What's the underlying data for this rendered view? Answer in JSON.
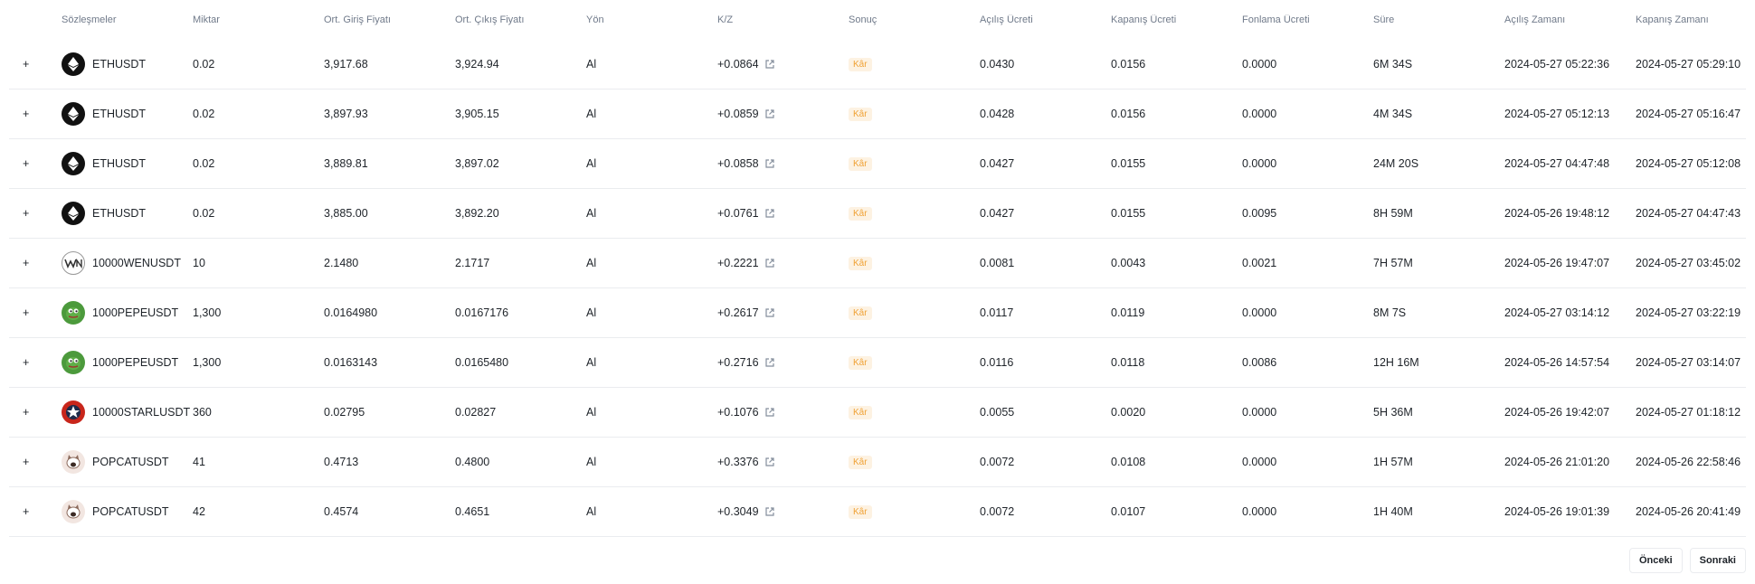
{
  "table": {
    "headers": [
      "Sözleşmeler",
      "Miktar",
      "Ort. Giriş Fiyatı",
      "Ort. Çıkış Fiyatı",
      "Yön",
      "K/Z",
      "Sonuç",
      "Açılış Ücreti",
      "Kapanış Ücreti",
      "Fonlama Ücreti",
      "Süre",
      "Açılış Zamanı",
      "Kapanış Zamanı"
    ],
    "rows": [
      {
        "contract": "ETHUSDT",
        "icon": "eth-icon",
        "qty": "0.02",
        "entry": "3,917.68",
        "exit": "3,924.94",
        "side": "Al",
        "pnl": "+0.0864",
        "result": "Kâr",
        "open_fee": "0.0430",
        "close_fee": "0.0156",
        "funding_fee": "0.0000",
        "duration": "6M 34S",
        "open_time": "2024-05-27 05:22:36",
        "close_time": "2024-05-27 05:29:10"
      },
      {
        "contract": "ETHUSDT",
        "icon": "eth-icon",
        "qty": "0.02",
        "entry": "3,897.93",
        "exit": "3,905.15",
        "side": "Al",
        "pnl": "+0.0859",
        "result": "Kâr",
        "open_fee": "0.0428",
        "close_fee": "0.0156",
        "funding_fee": "0.0000",
        "duration": "4M 34S",
        "open_time": "2024-05-27 05:12:13",
        "close_time": "2024-05-27 05:16:47"
      },
      {
        "contract": "ETHUSDT",
        "icon": "eth-icon",
        "qty": "0.02",
        "entry": "3,889.81",
        "exit": "3,897.02",
        "side": "Al",
        "pnl": "+0.0858",
        "result": "Kâr",
        "open_fee": "0.0427",
        "close_fee": "0.0155",
        "funding_fee": "0.0000",
        "duration": "24M 20S",
        "open_time": "2024-05-27 04:47:48",
        "close_time": "2024-05-27 05:12:08"
      },
      {
        "contract": "ETHUSDT",
        "icon": "eth-icon",
        "qty": "0.02",
        "entry": "3,885.00",
        "exit": "3,892.20",
        "side": "Al",
        "pnl": "+0.0761",
        "result": "Kâr",
        "open_fee": "0.0427",
        "close_fee": "0.0155",
        "funding_fee": "0.0095",
        "duration": "8H 59M",
        "open_time": "2024-05-26 19:48:12",
        "close_time": "2024-05-27 04:47:43"
      },
      {
        "contract": "10000WENUSDT",
        "icon": "wen-icon",
        "qty": "10",
        "entry": "2.1480",
        "exit": "2.1717",
        "side": "Al",
        "pnl": "+0.2221",
        "result": "Kâr",
        "open_fee": "0.0081",
        "close_fee": "0.0043",
        "funding_fee": "0.0021",
        "duration": "7H 57M",
        "open_time": "2024-05-26 19:47:07",
        "close_time": "2024-05-27 03:45:02"
      },
      {
        "contract": "1000PEPEUSDT",
        "icon": "pepe-icon",
        "qty": "1,300",
        "entry": "0.0164980",
        "exit": "0.0167176",
        "side": "Al",
        "pnl": "+0.2617",
        "result": "Kâr",
        "open_fee": "0.0117",
        "close_fee": "0.0119",
        "funding_fee": "0.0000",
        "duration": "8M 7S",
        "open_time": "2024-05-27 03:14:12",
        "close_time": "2024-05-27 03:22:19"
      },
      {
        "contract": "1000PEPEUSDT",
        "icon": "pepe-icon",
        "qty": "1,300",
        "entry": "0.0163143",
        "exit": "0.0165480",
        "side": "Al",
        "pnl": "+0.2716",
        "result": "Kâr",
        "open_fee": "0.0116",
        "close_fee": "0.0118",
        "funding_fee": "0.0086",
        "duration": "12H 16M",
        "open_time": "2024-05-26 14:57:54",
        "close_time": "2024-05-27 03:14:07"
      },
      {
        "contract": "10000STARLUSDT",
        "icon": "starl-icon",
        "qty": "360",
        "entry": "0.02795",
        "exit": "0.02827",
        "side": "Al",
        "pnl": "+0.1076",
        "result": "Kâr",
        "open_fee": "0.0055",
        "close_fee": "0.0020",
        "funding_fee": "0.0000",
        "duration": "5H 36M",
        "open_time": "2024-05-26 19:42:07",
        "close_time": "2024-05-27 01:18:12"
      },
      {
        "contract": "POPCATUSDT",
        "icon": "popcat-icon",
        "qty": "41",
        "entry": "0.4713",
        "exit": "0.4800",
        "side": "Al",
        "pnl": "+0.3376",
        "result": "Kâr",
        "open_fee": "0.0072",
        "close_fee": "0.0108",
        "funding_fee": "0.0000",
        "duration": "1H 57M",
        "open_time": "2024-05-26 21:01:20",
        "close_time": "2024-05-26 22:58:46"
      },
      {
        "contract": "POPCATUSDT",
        "icon": "popcat-icon",
        "qty": "42",
        "entry": "0.4574",
        "exit": "0.4651",
        "side": "Al",
        "pnl": "+0.3049",
        "result": "Kâr",
        "open_fee": "0.0072",
        "close_fee": "0.0107",
        "funding_fee": "0.0000",
        "duration": "1H 40M",
        "open_time": "2024-05-26 19:01:39",
        "close_time": "2024-05-26 20:41:49"
      }
    ]
  },
  "pagination": {
    "prev_label": "Önceki",
    "next_label": "Sonraki"
  },
  "colors": {
    "profit": "#0ecb81",
    "badge_bg": "#fdf2e2",
    "badge_text": "#f0a235",
    "header_text": "#707a8a",
    "border": "#eaecef"
  }
}
